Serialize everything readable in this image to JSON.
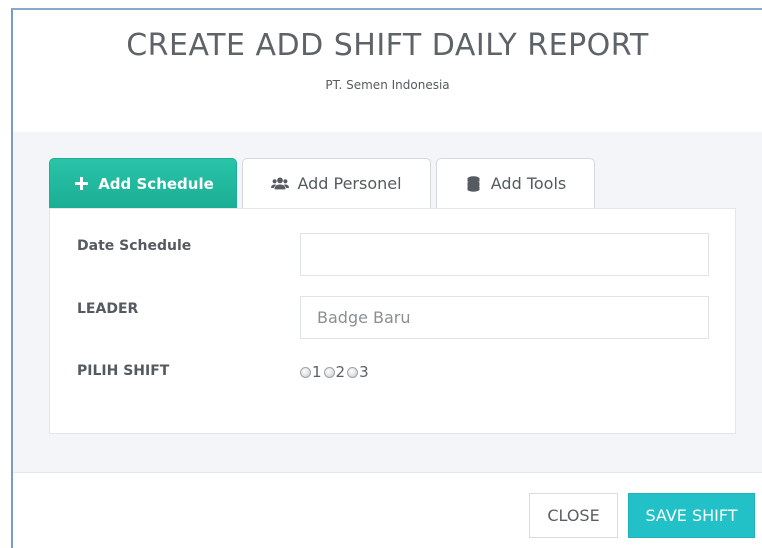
{
  "header": {
    "title": "CREATE ADD SHIFT DAILY REPORT",
    "subtitle": "PT. Semen Indonesia"
  },
  "tabs": [
    {
      "label": "Add Schedule",
      "icon": "plus-icon",
      "active": true
    },
    {
      "label": "Add Personel",
      "icon": "users-icon",
      "active": false
    },
    {
      "label": "Add Tools",
      "icon": "database-icon",
      "active": false
    }
  ],
  "form": {
    "date_schedule": {
      "label": "Date Schedule",
      "value": "",
      "placeholder": ""
    },
    "leader": {
      "label": "LEADER",
      "value": "",
      "placeholder": "Badge Baru"
    },
    "shift": {
      "label": "PILIH SHIFT",
      "options": [
        "1",
        "2",
        "3"
      ]
    }
  },
  "footer": {
    "close_label": "CLOSE",
    "save_label": "SAVE SHIFT"
  },
  "colors": {
    "active_tab": "#1fb89d",
    "save_button": "#22c1c8",
    "body_background": "#f3f5f8"
  }
}
